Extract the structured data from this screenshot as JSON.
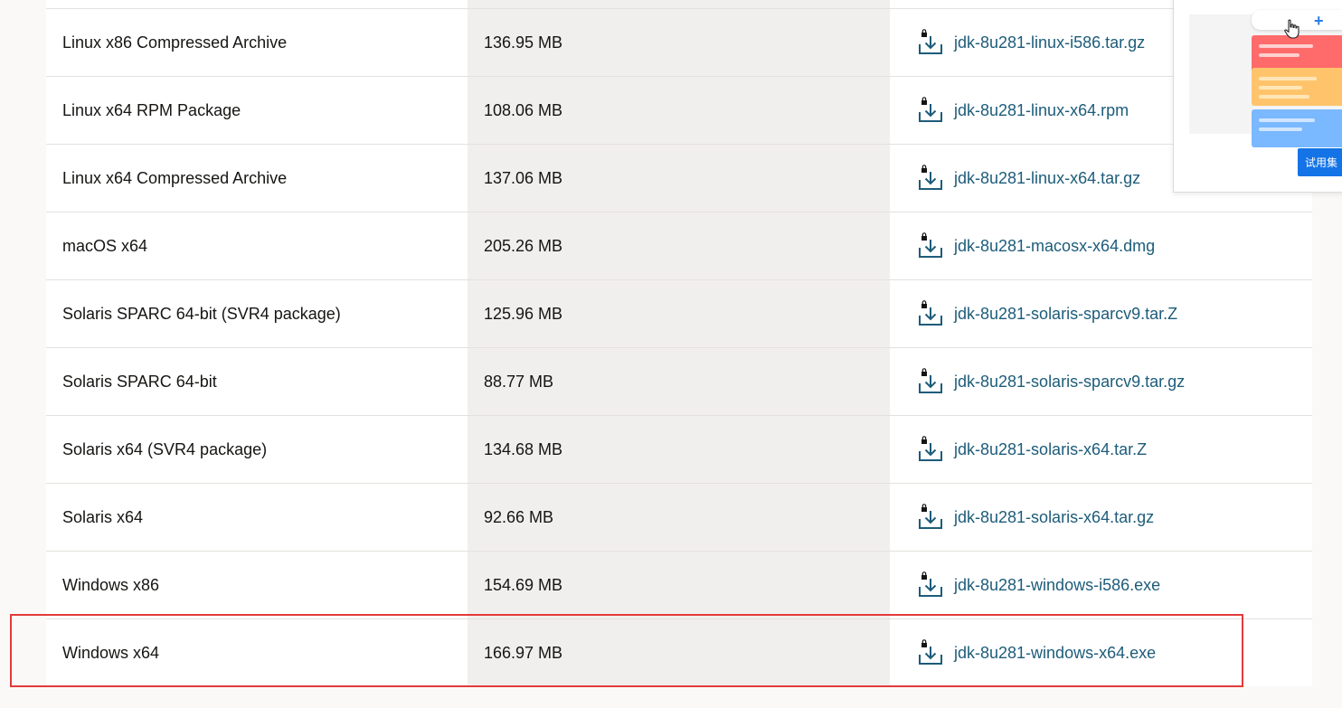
{
  "downloads": {
    "rows": [
      {
        "product": "",
        "size": "",
        "file": ""
      },
      {
        "product": "Linux x86 Compressed Archive",
        "size": "136.95 MB",
        "file": "jdk-8u281-linux-i586.tar.gz"
      },
      {
        "product": "Linux x64 RPM Package",
        "size": "108.06 MB",
        "file": "jdk-8u281-linux-x64.rpm"
      },
      {
        "product": "Linux x64 Compressed Archive",
        "size": "137.06 MB",
        "file": "jdk-8u281-linux-x64.tar.gz"
      },
      {
        "product": "macOS x64",
        "size": "205.26 MB",
        "file": "jdk-8u281-macosx-x64.dmg"
      },
      {
        "product": "Solaris SPARC 64-bit (SVR4 package)",
        "size": "125.96 MB",
        "file": "jdk-8u281-solaris-sparcv9.tar.Z"
      },
      {
        "product": "Solaris SPARC 64-bit",
        "size": "88.77 MB",
        "file": "jdk-8u281-solaris-sparcv9.tar.gz"
      },
      {
        "product": "Solaris x64 (SVR4 package)",
        "size": "134.68 MB",
        "file": "jdk-8u281-solaris-x64.tar.Z"
      },
      {
        "product": "Solaris x64",
        "size": "92.66 MB",
        "file": "jdk-8u281-solaris-x64.tar.gz"
      },
      {
        "product": "Windows x86",
        "size": "154.69 MB",
        "file": "jdk-8u281-windows-i586.exe"
      },
      {
        "product": "Windows x64",
        "size": "166.97 MB",
        "file": "jdk-8u281-windows-x64.exe"
      }
    ],
    "highlighted_row": "Windows x64"
  },
  "ad": {
    "plus": "+",
    "button_label": "试用集"
  },
  "colors": {
    "link": "#1d5c7a",
    "highlight": "#e23b3b",
    "ad_button": "#1473e6"
  },
  "icons": {
    "download": "download-locked-icon",
    "cursor": "hand-cursor-icon"
  }
}
